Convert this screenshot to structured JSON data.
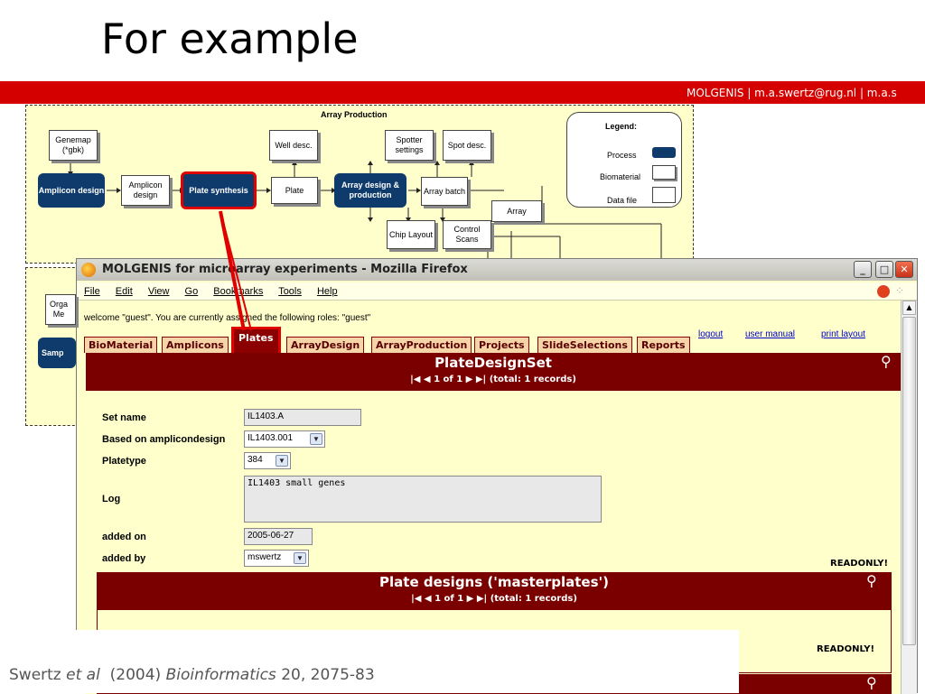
{
  "slide": {
    "title": "For example",
    "header_text": "MOLGENIS  |  m.a.swertz@rug.nl  |  m.a.s",
    "citation": {
      "author": "Swertz ",
      "etal": "et al",
      "year": "  (2004) ",
      "journal": "Bioinformatics",
      "volume": " 20, 2075-83"
    }
  },
  "diagram": {
    "title": "Array Production",
    "nodes": {
      "genemap": "Genemap (*gbk)",
      "amplicon_design_proc": "Amplicon design",
      "amplicon_design_bio": "Amplicon design",
      "plate_synthesis": "Plate synthesis",
      "plate": "Plate",
      "well_desc": "Well desc.",
      "array_design": "Array design & production",
      "spotter_settings": "Spotter settings",
      "spot_desc": "Spot desc.",
      "array_batch": "Array batch",
      "array": "Array",
      "chip_layout": "Chip Layout",
      "control_scans": "Control Scans"
    },
    "legend": {
      "title": "Legend:",
      "process": "Process",
      "biomaterial": "Biomaterial",
      "datafile": "Data file"
    },
    "lower": {
      "org": "Orga\nMe",
      "samp": "Samp"
    }
  },
  "browser": {
    "window_title": "MOLGENIS for microarray experiments - Mozilla Firefox",
    "menu": [
      "File",
      "Edit",
      "View",
      "Go",
      "Bookmarks",
      "Tools",
      "Help"
    ],
    "welcome": "welcome \"guest\". You are currently assigned the following roles: \"guest\"",
    "links": {
      "logout": "logout",
      "manual": "user manual",
      "print": "print layout"
    },
    "tabs": [
      "BioMaterial",
      "Amplicons",
      "Plates",
      "ArrayDesign",
      "ArrayProduction",
      "Projects",
      "SlideSelections",
      "Reports"
    ],
    "active_tab": "Plates",
    "panel": {
      "title": "PlateDesignSet",
      "pager": "1 of 1",
      "total": "(total: 1 records)"
    },
    "form": {
      "set_name_label": "Set name",
      "set_name_value": "IL1403.A",
      "amplicondesign_label": "Based on amplicondesign",
      "amplicondesign_value": "IL1403.001",
      "platetype_label": "Platetype",
      "platetype_value": "384",
      "log_label": "Log",
      "log_value": "IL1403 small genes",
      "added_on_label": "added on",
      "added_on_value": "2005-06-27",
      "added_by_label": "added by",
      "added_by_value": "mswertz"
    },
    "readonly": "READONLY!",
    "subpanel": {
      "title": "Plate designs ('masterplates')",
      "pager": "1 of 1",
      "total": "(total: 1 records)"
    }
  },
  "colors": {
    "accent_red": "#d40000",
    "panel_maroon": "#7a0000",
    "process_blue": "#0e3b6b",
    "background_yellow": "#ffffcc"
  }
}
